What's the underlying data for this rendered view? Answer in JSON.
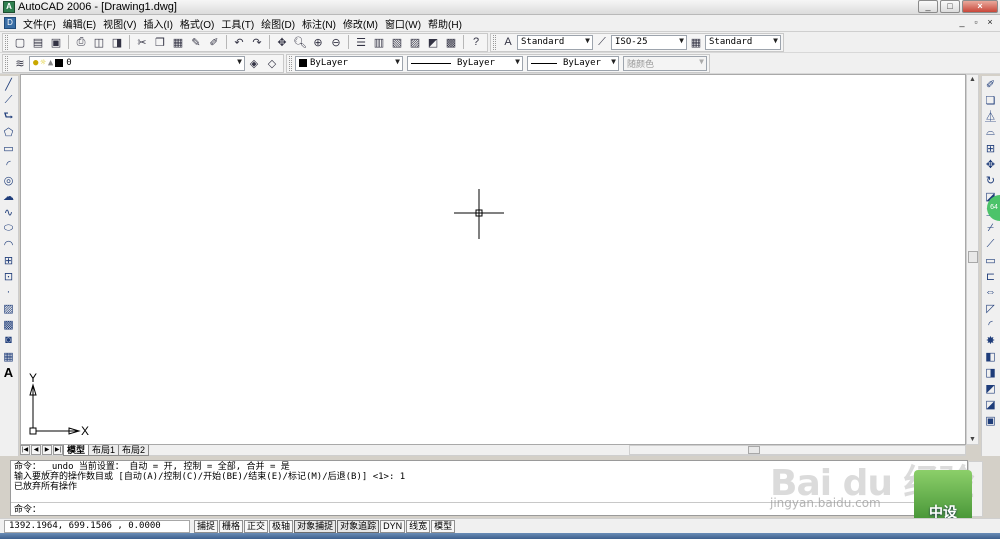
{
  "window": {
    "title": "AutoCAD 2006 - [Drawing1.dwg]",
    "min": "_",
    "max": "□",
    "close": "×"
  },
  "menubar": {
    "items": [
      "文件(F)",
      "编辑(E)",
      "视图(V)",
      "插入(I)",
      "格式(O)",
      "工具(T)",
      "绘图(D)",
      "标注(N)",
      "修改(M)",
      "窗口(W)",
      "帮助(H)"
    ],
    "mdi_min": "_",
    "mdi_max": "▫",
    "mdi_close": "×"
  },
  "styles_toolbar": {
    "text_style": "Standard",
    "dim_style": "ISO-25",
    "table_style": "Standard"
  },
  "layers_toolbar": {
    "current_layer": "0",
    "color": "ByLayer",
    "linetype": "ByLayer",
    "lineweight": "ByLayer",
    "plot_style": "随颜色"
  },
  "layout_tabs": {
    "tabs": [
      "模型",
      "布局1",
      "布局2"
    ],
    "active": "模型"
  },
  "ucs": {
    "x_label": "X",
    "y_label": "Y"
  },
  "command_window": {
    "lines": [
      "命令： _undo 当前设置： 自动 = 开, 控制 = 全部, 合并 = 是",
      "输入要放弃的操作数目或 [自动(A)/控制(C)/开始(BE)/结束(E)/标记(M)/后退(B)] <1>: 1",
      "已放弃所有操作"
    ],
    "prompt": "命令："
  },
  "status": {
    "coordinates": "1392.1964, 699.1506 , 0.0000",
    "buttons": [
      "捕捉",
      "栅格",
      "正交",
      "极轴",
      "对象捕捉",
      "对象追踪",
      "DYN",
      "线宽",
      "模型"
    ]
  },
  "watermark": {
    "logo": "Bai du 经验",
    "url": "jingyan.baidu.com",
    "badge": "中设"
  },
  "side_badge": "64"
}
